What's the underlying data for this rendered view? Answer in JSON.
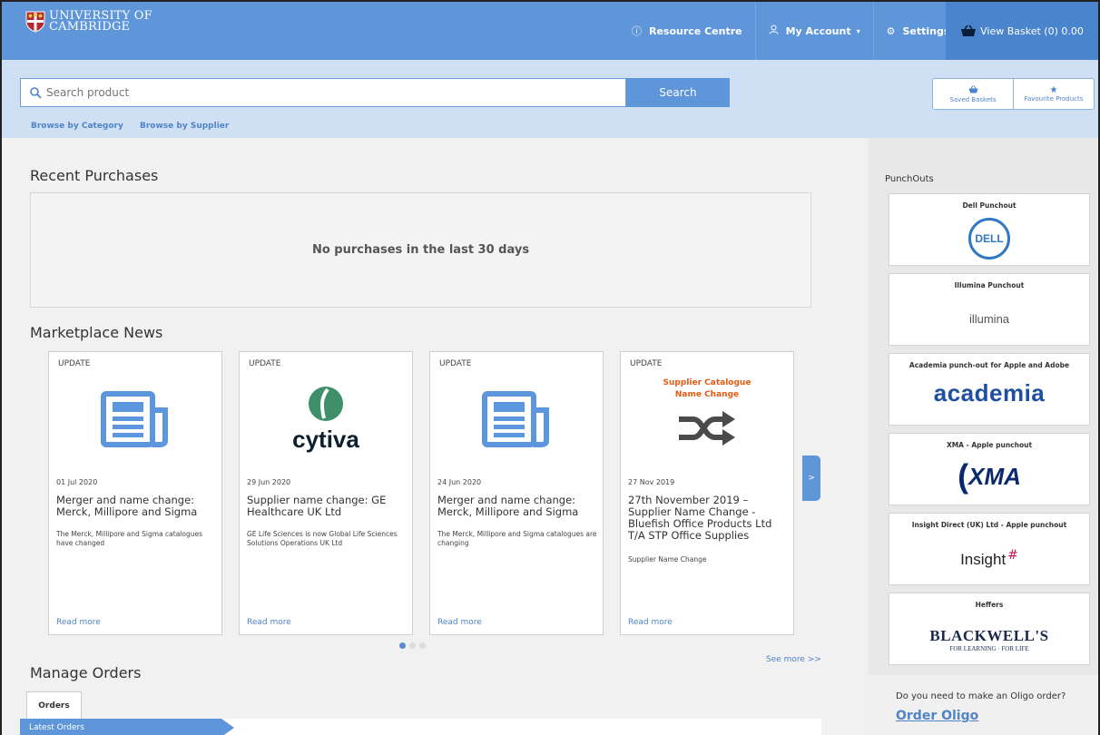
{
  "header": {
    "logo_line1": "UNIVERSITY OF",
    "logo_line2": "CAMBRIDGE",
    "resource_centre": "Resource Centre",
    "my_account": "My Account",
    "settings": "Settings",
    "basket": "View Basket (0) 0.00"
  },
  "search": {
    "placeholder": "Search product",
    "button": "Search",
    "browse_category": "Browse by Category",
    "browse_supplier": "Browse by Supplier",
    "saved_baskets": "Saved Baskets",
    "favourite_products": "Favourite Products"
  },
  "recent": {
    "title": "Recent Purchases",
    "empty": "No purchases in the last 30 days"
  },
  "news": {
    "title": "Marketplace News",
    "cards": [
      {
        "tag": "UPDATE",
        "date": "01 Jul 2020",
        "title": "Merger and name change: Merck, Millipore and Sigma",
        "desc": "The Merck, Millipore and Sigma catalogues have changed",
        "more": "Read more",
        "icon": "newspaper-icon"
      },
      {
        "tag": "UPDATE",
        "date": "29 Jun 2020",
        "title": "Supplier name change: GE Healthcare UK Ltd",
        "desc": "GE Life Sciences is now Global Life Sciences Solutions Operations UK Ltd",
        "more": "Read more",
        "icon": "cytiva-logo",
        "logo_text": "cytiva"
      },
      {
        "tag": "UPDATE",
        "date": "24 Jun 2020",
        "title": "Merger and name change: Merck, Millipore and Sigma",
        "desc": "The Merck, Millipore and Sigma catalogues are changing",
        "more": "Read more",
        "icon": "newspaper-icon"
      },
      {
        "tag": "UPDATE",
        "date": "27 Nov 2019",
        "title": "27th November 2019 – Supplier Name Change - Bluefish Office Products Ltd T/A STP Office Supplies",
        "desc": "Supplier Name Change",
        "more": "Read more",
        "icon": "shuffle-icon",
        "art_heading_1": "Supplier Catalogue",
        "art_heading_2": "Name Change"
      }
    ],
    "next": ">",
    "see_more": "See more >>"
  },
  "orders": {
    "title": "Manage Orders",
    "tab": "Orders",
    "latest": "Latest Orders"
  },
  "sidebar": {
    "punchouts_title": "PunchOuts",
    "punchouts": [
      {
        "title": "Dell Punchout",
        "logo": "DELL"
      },
      {
        "title": "Illumina Punchout",
        "logo": "illumina"
      },
      {
        "title": "Academia punch-out for Apple and Adobe",
        "logo": "academia"
      },
      {
        "title": "XMA - Apple punchout",
        "logo": "XMA"
      },
      {
        "title": "Insight Direct (UK) Ltd - Apple punchout",
        "logo": "Insight"
      },
      {
        "title": "Heffers",
        "logo": "BLACKWELL'S",
        "logo_sub": "FOR LEARNING · FOR LIFE"
      }
    ],
    "oligo_question": "Do you need to make an Oligo order?",
    "oligo_link": "Order Oligo"
  },
  "colors": {
    "header_blue": "#5e96d9",
    "band_blue": "#cfe0f4",
    "link_blue": "#4f84c6",
    "orange": "#e35b14",
    "academia_blue": "#1f4fa0"
  }
}
